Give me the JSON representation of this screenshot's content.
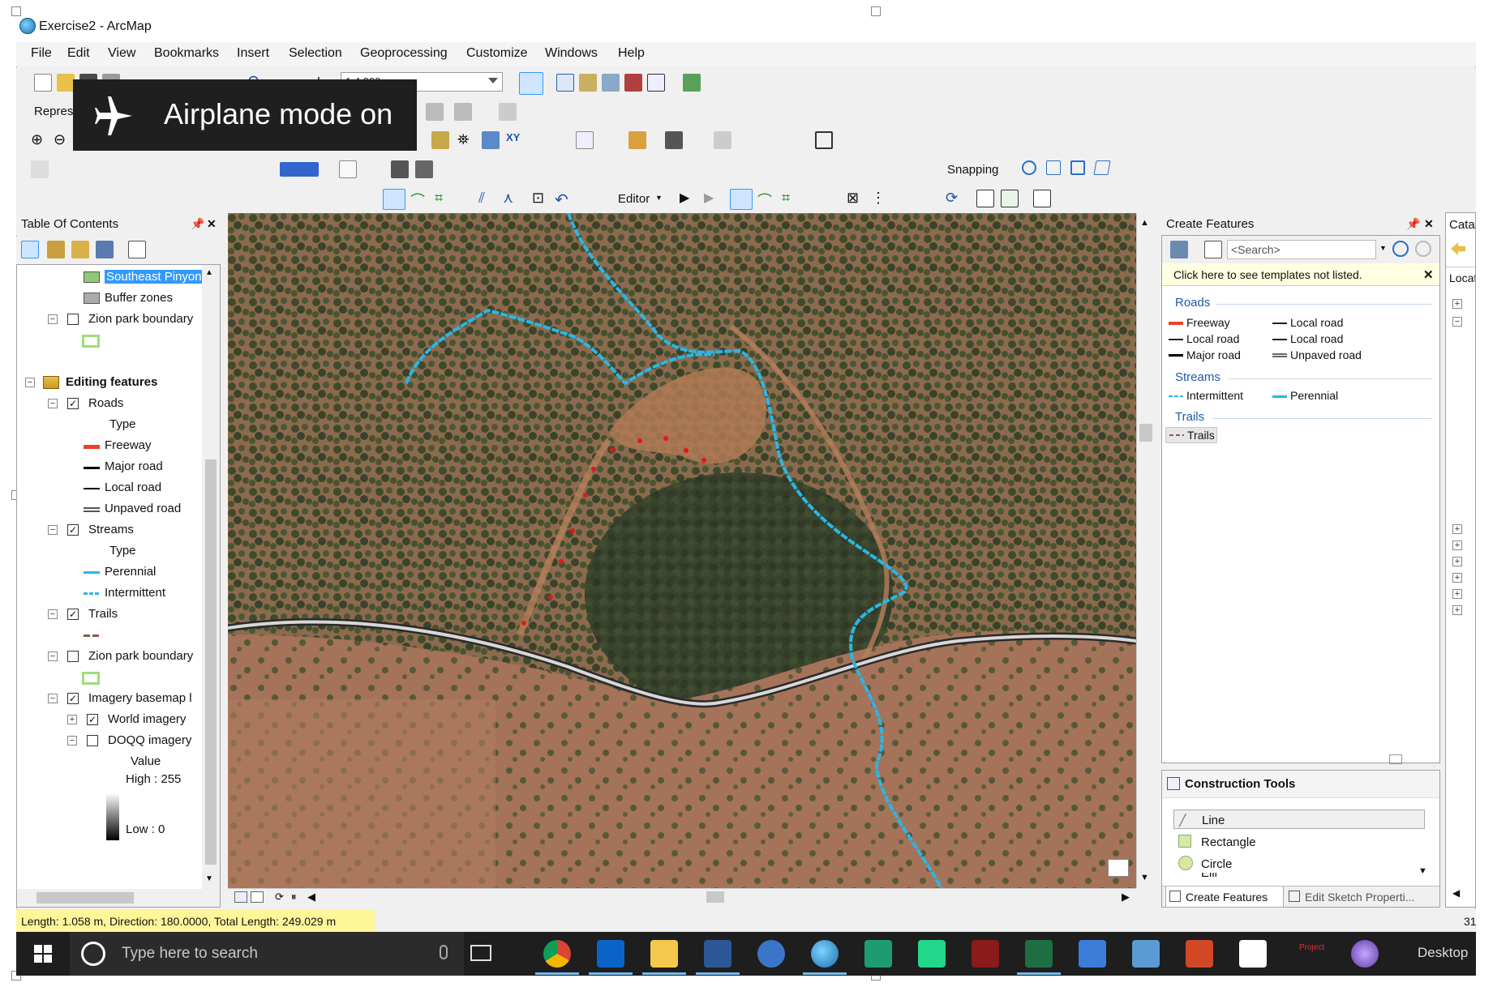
{
  "window": {
    "title": "Exercise2 - ArcMap"
  },
  "menu": [
    "File",
    "Edit",
    "View",
    "Bookmarks",
    "Insert",
    "Selection",
    "Geoprocessing",
    "Customize",
    "Windows",
    "Help"
  ],
  "toolbar": {
    "scale_value": "1:4,000",
    "representation_label": "Repres",
    "snapping_label": "Snapping",
    "editor_label": "Editor"
  },
  "toast": {
    "text": "Airplane mode on"
  },
  "toc": {
    "title": "Table Of Contents",
    "rows": {
      "southeast": "Southeast Pinyon",
      "buffer": "Buffer zones",
      "zion1": "Zion park boundary",
      "editing": "Editing features",
      "roads": "Roads",
      "roads_type": "Type",
      "freeway": "Freeway",
      "major": "Major road",
      "local": "Local road",
      "unpaved": "Unpaved road",
      "streams": "Streams",
      "streams_type": "Type",
      "perennial": "Perennial",
      "intermittent": "Intermittent",
      "trails": "Trails",
      "zion2": "Zion park boundary",
      "imagery": "Imagery basemap l",
      "world": "World imagery",
      "doqq": "DOQQ imagery",
      "value": "Value",
      "high": "High : 255",
      "low": "Low : 0"
    }
  },
  "create_features": {
    "title": "Create Features",
    "search_placeholder": "<Search>",
    "notice": "Click here to see templates not listed.",
    "groups": {
      "roads": "Roads",
      "streams": "Streams",
      "trails": "Trails"
    },
    "items": {
      "freeway": "Freeway",
      "local_road_a": "Local road",
      "local_road_b": "Local road",
      "local_road_c": "Local road",
      "major_road": "Major road",
      "unpaved_road": "Unpaved road",
      "intermittent": "Intermittent",
      "perennial": "Perennial",
      "trails": "Trails"
    }
  },
  "construction_tools": {
    "title": "Construction Tools",
    "items": [
      "Line",
      "Rectangle",
      "Circle"
    ],
    "partial_item": "Elli",
    "tab_create": "Create Features",
    "tab_sketch": "Edit Sketch Properti..."
  },
  "catalog": {
    "title": "Catal",
    "location": "Locati"
  },
  "status": {
    "text": "Length: 1.058 m, Direction: 180.0000, Total Length: 249.029 m",
    "right_fragment": "31"
  },
  "taskbar": {
    "search_placeholder": "Type here to search",
    "desktop_label": "Desktop",
    "project_label": "Project"
  },
  "colors": {
    "freeway": "#e8432a",
    "stream": "#2ab6e6",
    "trail_vertex": "#e01818",
    "highlight": "#fff69a",
    "selection": "#3399ff"
  }
}
